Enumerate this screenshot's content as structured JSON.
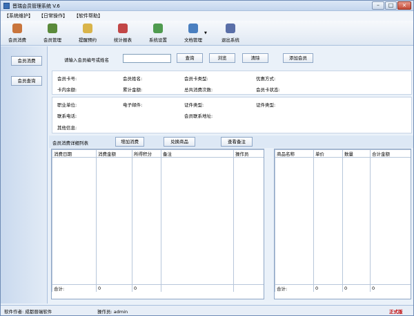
{
  "window": {
    "title": "晋瑞会员管理系统 V.6"
  },
  "menu": [
    "【系统维护】",
    "【日常操作】",
    "【软件帮助】"
  ],
  "toolbar": [
    {
      "label": "会员消费",
      "icon": "coins-icon",
      "color": "#c9753c"
    },
    {
      "label": "会员管理",
      "icon": "users-icon",
      "color": "#5a8a3a"
    },
    {
      "label": "提醒预约",
      "icon": "reminder-icon",
      "color": "#d9b44a"
    },
    {
      "label": "统计报表",
      "icon": "report-icon",
      "color": "#c24646"
    },
    {
      "label": "系统设置",
      "icon": "settings-icon",
      "color": "#4f9b4f"
    },
    {
      "label": "文档管理",
      "icon": "document-icon",
      "color": "#4a7fc0"
    },
    {
      "label": "退出系统",
      "icon": "exit-icon",
      "color": "#5a6fa8"
    }
  ],
  "sidebar": {
    "items": [
      "会员消费",
      "会员查询"
    ]
  },
  "search": {
    "prompt": "请输入会员编号或姓名",
    "value": "",
    "buttons": [
      "查询",
      "浏览",
      "清除",
      "添加会员"
    ]
  },
  "member_info": {
    "row1": [
      "会员卡号:",
      "会员姓名:",
      "会员卡类型:",
      "优惠方式:"
    ],
    "row2": [
      "卡内余额:",
      "累计金额:",
      "总共消费次数:",
      "会员卡状态:"
    ],
    "row3": [
      "职业单位:",
      "电子邮件:",
      "证件类型:",
      "证件类型:"
    ],
    "row4": [
      "联系电话:",
      "会员联系地址:"
    ],
    "row5": [
      "其他信息:"
    ]
  },
  "detail": {
    "title": "会员消费详细列表",
    "buttons": [
      "增加消费",
      "兑换商品",
      "查看备注"
    ]
  },
  "consumption_table": {
    "headers": [
      "消费日期",
      "消费金额",
      "所得积分",
      "备注",
      "操作员"
    ],
    "total_row": [
      "合计:",
      "0",
      "0",
      "",
      ""
    ]
  },
  "product_table": {
    "headers": [
      "商品名称",
      "单价",
      "数量",
      "合计金额"
    ],
    "total_row": [
      "合计:",
      "0",
      "0",
      "0"
    ]
  },
  "status": {
    "author": "软件作者: 成都晋瑞软件",
    "operator": "操作员: admin",
    "edition": "正式版",
    "edition_color": "#c00000"
  }
}
